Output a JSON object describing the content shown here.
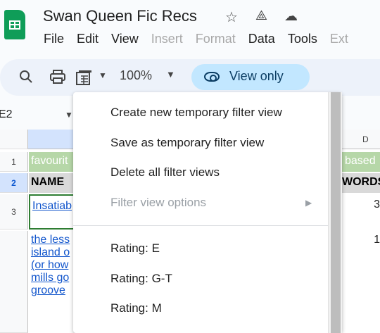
{
  "app": {
    "title": "Swan Queen Fic Recs",
    "title_icons": [
      "star-icon",
      "move-to-drive-icon",
      "cloud-status-icon"
    ]
  },
  "menubar": {
    "items": [
      "File",
      "Edit",
      "View",
      "Insert",
      "Format",
      "Data",
      "Tools",
      "Ext"
    ],
    "disabled": [
      "Insert",
      "Format"
    ]
  },
  "toolbar": {
    "icons": [
      "search-icon",
      "print-icon",
      "filter-views-icon"
    ],
    "zoom": "100%",
    "view_only_label": "View only"
  },
  "namebox": {
    "value": "E2"
  },
  "sheet": {
    "col_d_label": "D",
    "rows": [
      {
        "num": "1",
        "left_text": "favourit",
        "right_text": "based"
      },
      {
        "num": "2",
        "left_text": "NAME",
        "right_text": "WORDS"
      },
      {
        "num": "3",
        "left_text": "Insatiab",
        "right_text": "3"
      },
      {
        "num": "",
        "left_lines": [
          "the less",
          "island o",
          "(or how",
          "mills go",
          "groove"
        ],
        "right_text": "1"
      }
    ]
  },
  "filter_menu": {
    "items": [
      {
        "label": "Create new temporary filter view",
        "disabled": false
      },
      {
        "label": "Save as temporary filter view",
        "disabled": false
      },
      {
        "label": "Delete all filter views",
        "disabled": false
      },
      {
        "label": "Filter view options",
        "disabled": true,
        "submenu": true
      },
      {
        "label": "Rating: E",
        "disabled": false
      },
      {
        "label": "Rating: G-T",
        "disabled": false
      },
      {
        "label": "Rating: M",
        "disabled": false
      }
    ]
  },
  "colors": {
    "brand_green": "#0f9d58",
    "toolbar_bg": "#edf2fa",
    "view_only_bg": "#c2e7ff",
    "row1_green": "#b6d7a8",
    "header_gray": "#d9d9d9",
    "link_blue": "#1155cc"
  }
}
